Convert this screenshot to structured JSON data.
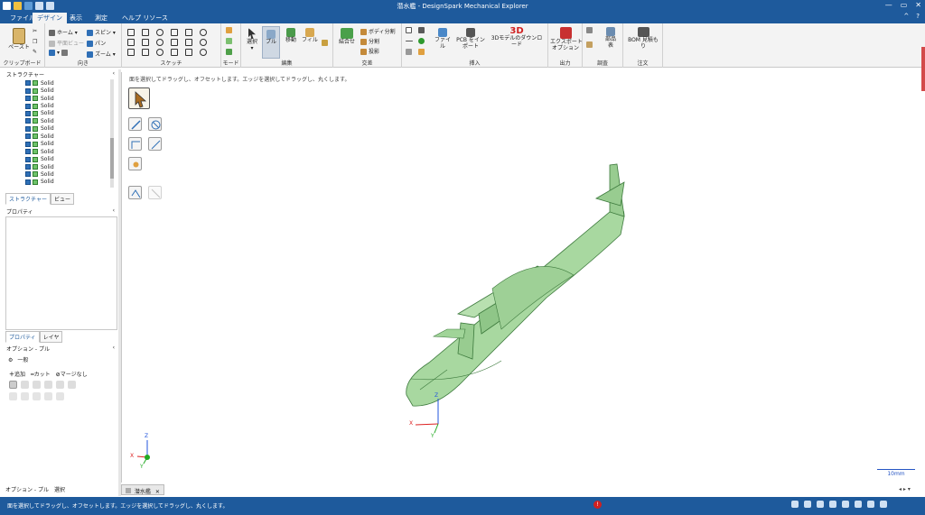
{
  "window": {
    "title": "潜水艦 - DesignSpark Mechanical Explorer",
    "controls": [
      "—",
      "▭",
      "✕"
    ]
  },
  "menubar": {
    "tabs": [
      "ファイル",
      "デザイン",
      "表示",
      "測定",
      "ヘルプ リソース"
    ],
    "help_icons": [
      "^",
      "?"
    ]
  },
  "ribbon": {
    "clipboard": {
      "label": "クリップボード",
      "paste": "ペースト"
    },
    "orient": {
      "label": "向き",
      "home": "ホーム",
      "plane_view": "平面ビュー",
      "spin": "スピン",
      "pan": "パン",
      "zoom": "ズーム"
    },
    "sketch": {
      "label": "スケッチ"
    },
    "mode": {
      "label": "モード"
    },
    "edit": {
      "label": "編集",
      "select": "選択",
      "pull": "プル",
      "move": "移動",
      "fill": "フィル"
    },
    "intersect": {
      "label": "交差",
      "combine": "結合せ",
      "split_body": "ボディ分割",
      "split": "分割",
      "project": "投影"
    },
    "insert": {
      "label": "挿入",
      "file": "ファイル",
      "pcb": "PCB をイン\nポート",
      "download_3d": "3Dモデルのダウンロード",
      "icon_3d": "3D"
    },
    "output": {
      "label": "出力",
      "export": "エクスポート\nオプション"
    },
    "investigate": {
      "label": "調査",
      "parts_table": "部品\n表"
    },
    "order": {
      "label": "注文",
      "bom": "BOM 見積も\nり"
    }
  },
  "structure": {
    "title": "ストラクチャー",
    "pin": "‹",
    "items": [
      "Solid",
      "Solid",
      "Solid",
      "Solid",
      "Solid",
      "Solid",
      "Solid",
      "Solid",
      "Solid",
      "Solid",
      "Solid",
      "Solid",
      "Solid",
      "Solid"
    ],
    "tabs": [
      "ストラクチャー",
      "ビュー"
    ]
  },
  "properties": {
    "title": "プロパティ",
    "pin": "‹",
    "tabs": [
      "プロパティ",
      "レイヤ"
    ]
  },
  "options": {
    "title": "オプション - プル",
    "pin": "‹",
    "section": "一般",
    "add": "追加",
    "cut": "カット",
    "no_merge": "マージなし"
  },
  "bottom_panel_tabs": [
    "オプション - プル",
    "選択"
  ],
  "viewport": {
    "hint": "面を選択してドラッグし、オフセットします。エッジを選択してドラッグし、丸くします。",
    "scale": "10mm",
    "axes": {
      "x": "X",
      "y": "Y",
      "z": "Z"
    }
  },
  "doc_tab": {
    "name": "潜水艦",
    "close": "✕"
  },
  "status": {
    "message": "面を選択してドラッグし、オフセットします。エッジを選択してドラッグし、丸くします。",
    "alert": "!"
  },
  "colors": {
    "accent": "#1e5a9c",
    "model_fill": "#a8d8a0",
    "model_edge": "#3d7a3d"
  }
}
